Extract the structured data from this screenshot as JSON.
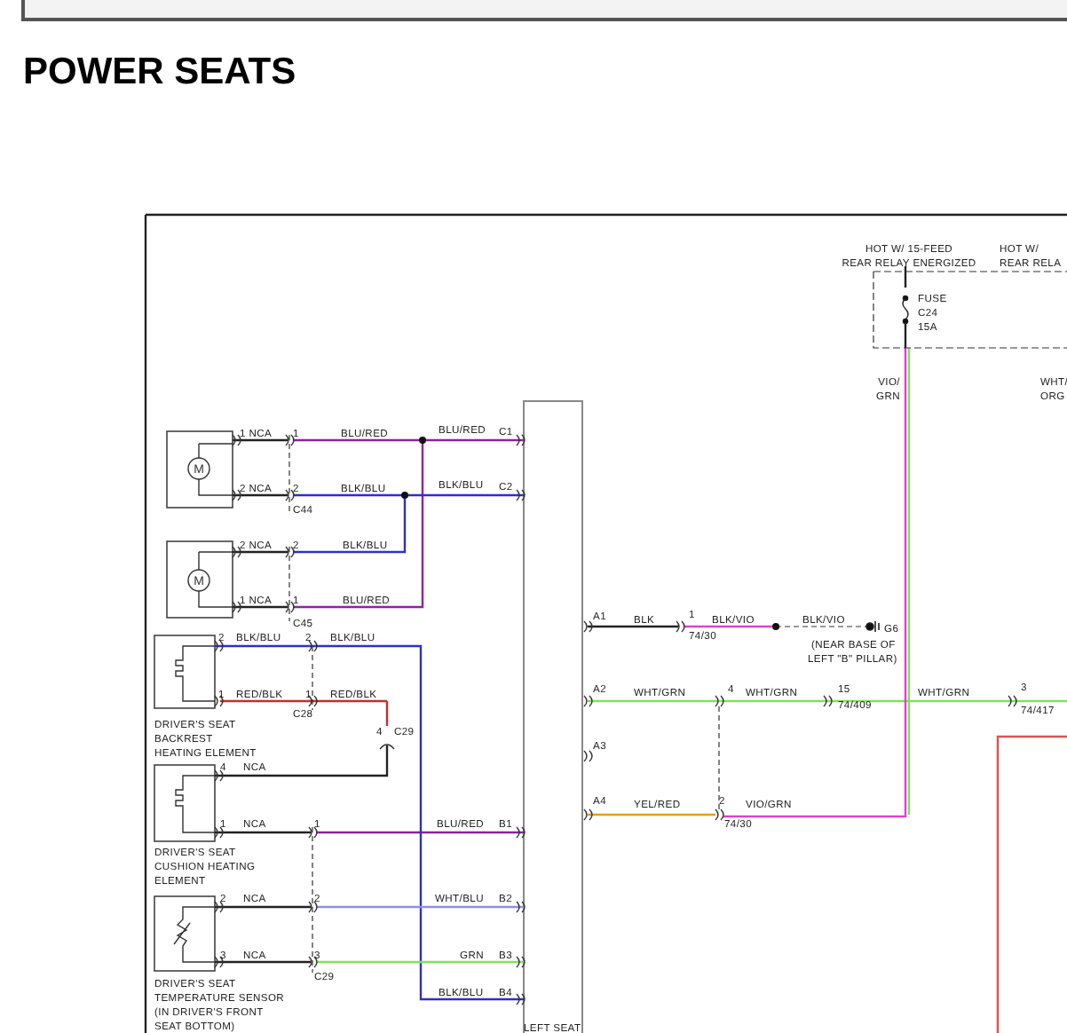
{
  "page_heading": "POWER SEATS",
  "diagram": {
    "motor_letters": [
      "M",
      "M"
    ],
    "labels": [
      "HOT W/ 15-FEED",
      "REAR RELAY ENERGIZED",
      "HOT W/",
      "REAR RELA",
      "FUSE",
      "C24",
      "15A",
      "VIO/",
      "GRN",
      "WHT/",
      "ORG",
      "1 NCA",
      "1",
      "BLU/RED",
      "BLU/RED",
      "C1",
      "2 NCA",
      "2",
      "BLK/BLU",
      "BLK/BLU",
      "C2",
      "C44",
      "2 NCA",
      "2",
      "BLK/BLU",
      "1 NCA",
      "1",
      "BLU/RED",
      "C45",
      "2",
      "BLK/BLU",
      "2",
      "BLK/BLU",
      "1",
      "RED/BLK",
      "1",
      "RED/BLK",
      "C28",
      "DRIVER'S SEAT",
      "BACKREST",
      "HEATING ELEMENT",
      "4",
      "C29",
      "4",
      "NCA",
      "1",
      "NCA",
      "1",
      "BLU/RED",
      "B1",
      "DRIVER'S SEAT",
      "CUSHION HEATING",
      "ELEMENT",
      "2",
      "NCA",
      "2",
      "WHT/BLU",
      "B2",
      "3",
      "NCA",
      "3",
      "GRN",
      "B3",
      "C29",
      "BLK/BLU",
      "B4",
      "DRIVER'S SEAT",
      "TEMPERATURE SENSOR",
      "(IN DRIVER'S FRONT",
      "SEAT BOTTOM)",
      "LEFT SEAT",
      "A1",
      "BLK",
      "1",
      "BLK/VIO",
      "74/30",
      "BLK/VIO",
      "G6",
      "(NEAR BASE OF",
      "LEFT \"B\" PILLAR)",
      "A2",
      "WHT/GRN",
      "4",
      "WHT/GRN",
      "15",
      "74/409",
      "WHT/GRN",
      "3",
      "74/417",
      "A3",
      "A4",
      "YEL/RED",
      "2",
      "VIO/GRN",
      "74/30"
    ]
  }
}
